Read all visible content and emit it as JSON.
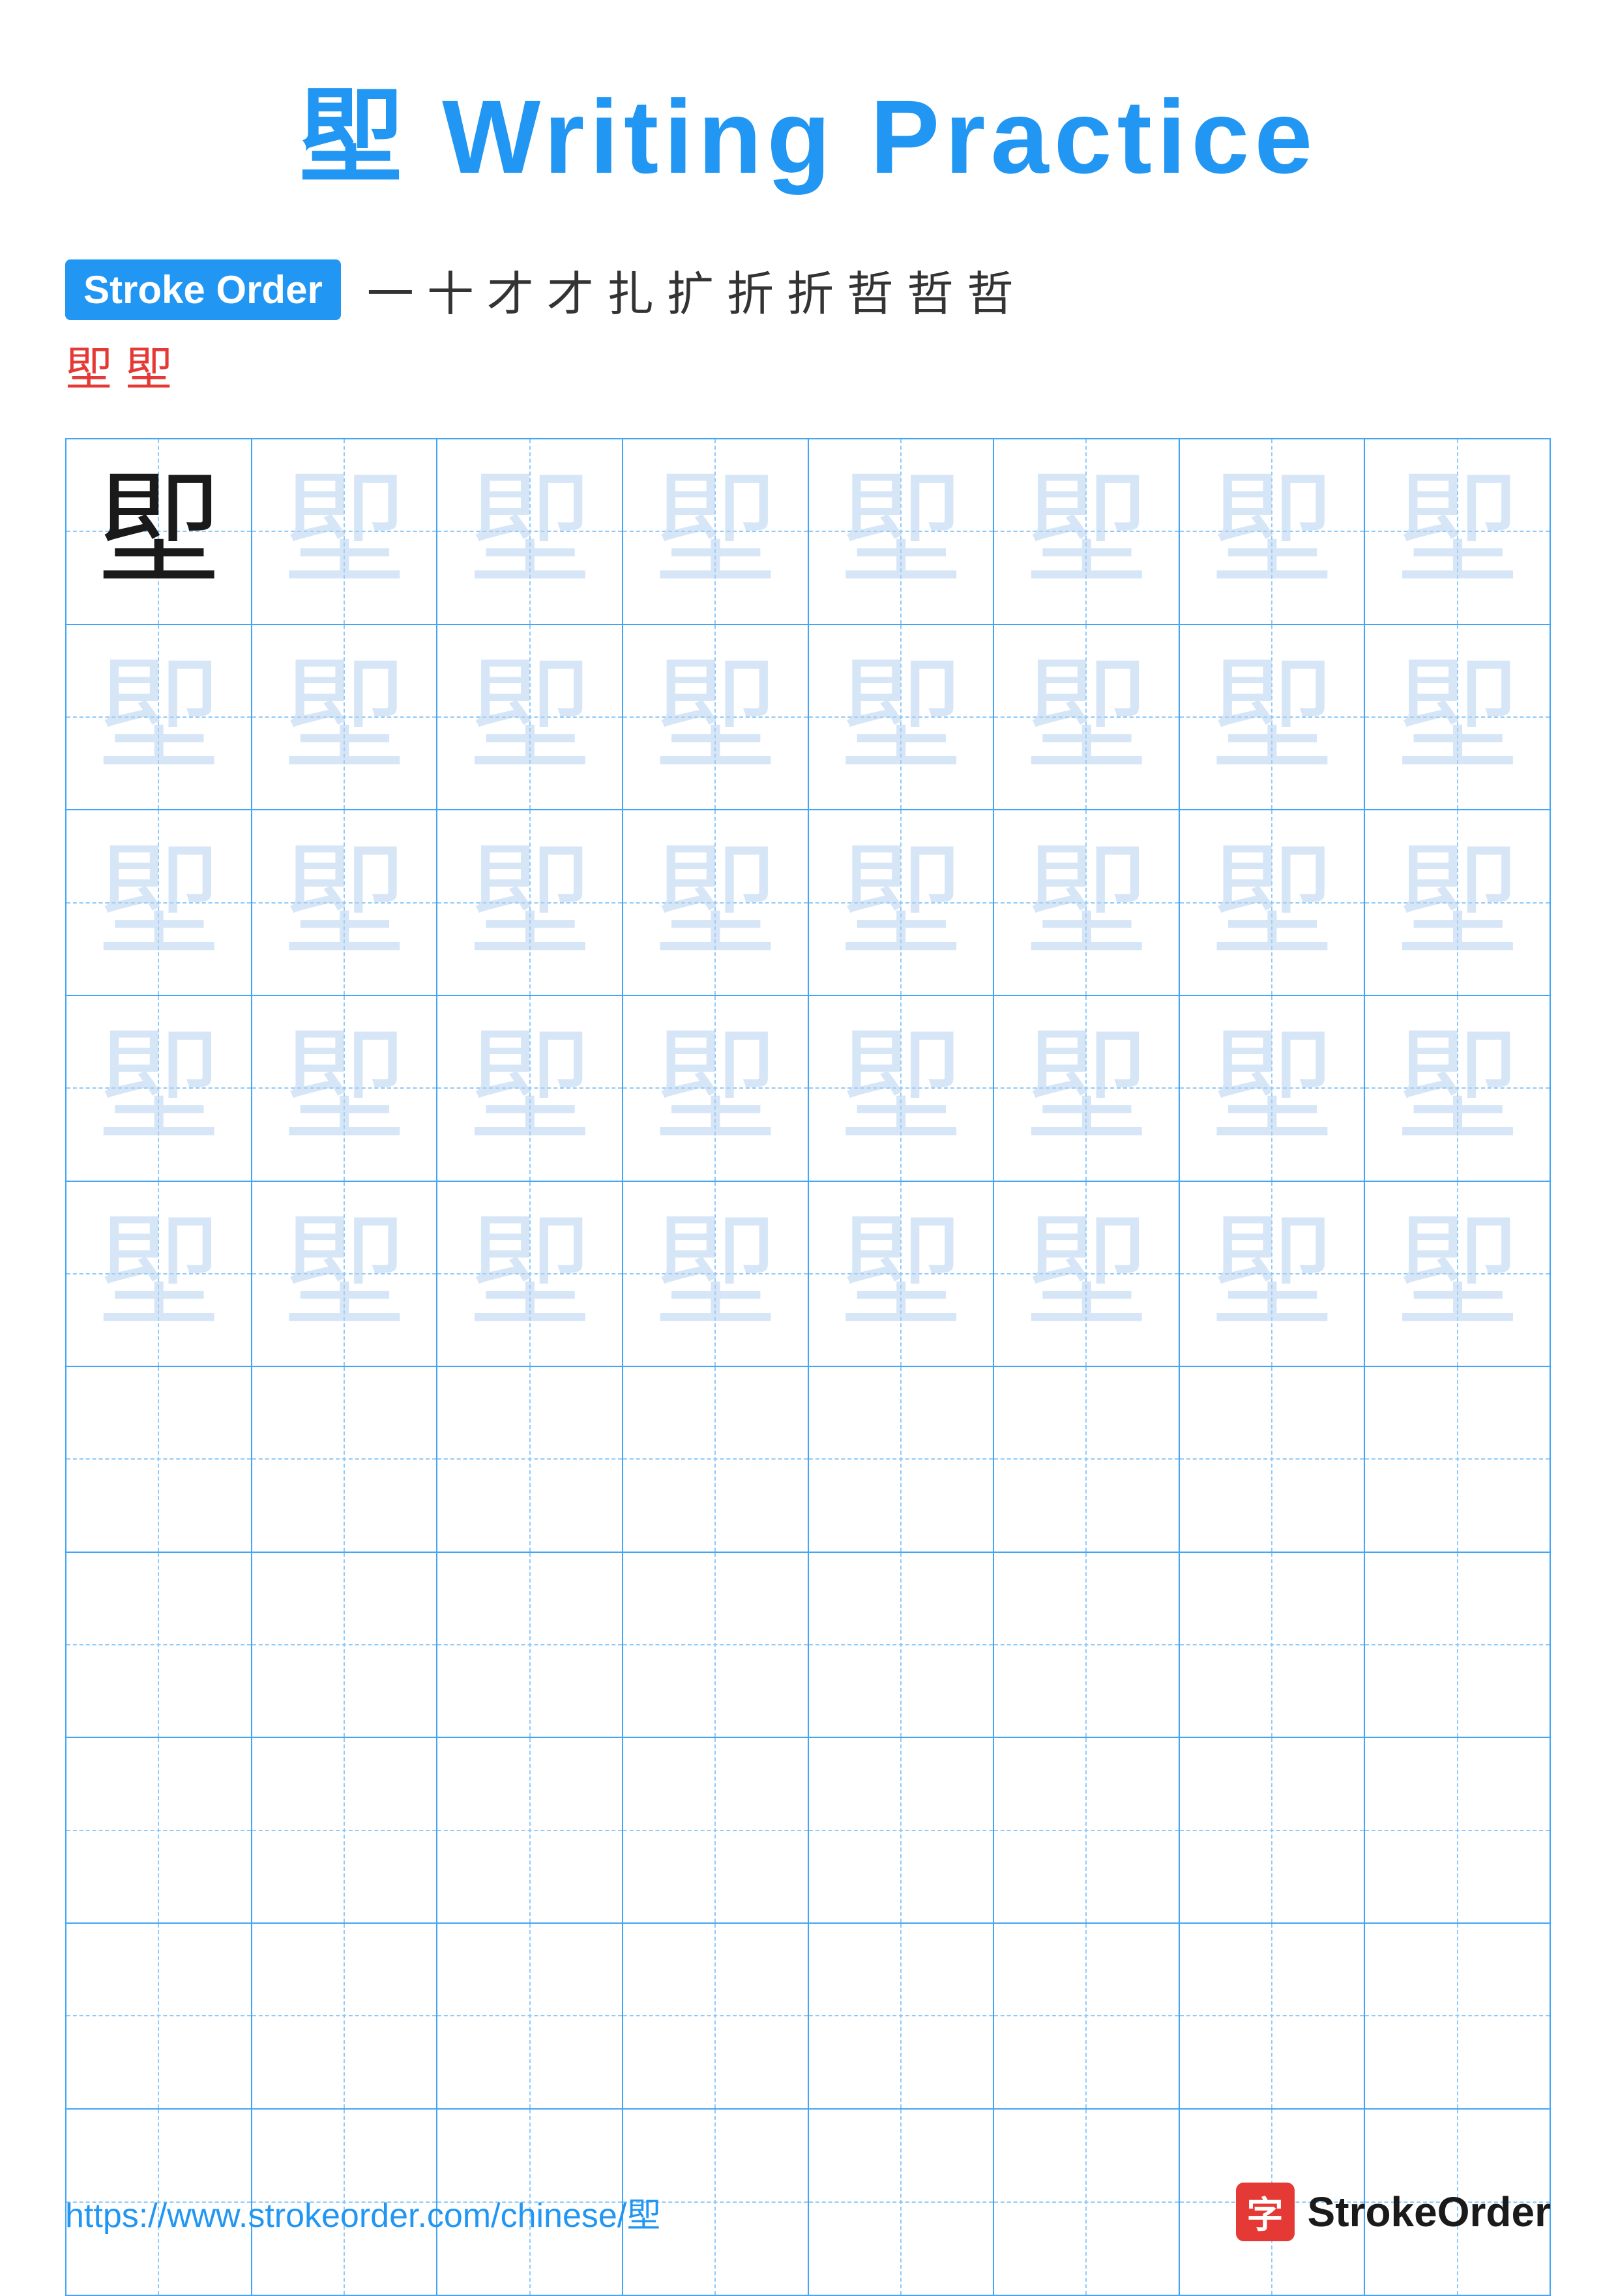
{
  "title": "堲 Writing Practice",
  "stroke_order": {
    "label": "Stroke Order",
    "strokes": [
      "一",
      "十",
      "才",
      "才",
      "扎",
      "扩",
      "折",
      "折",
      "哲",
      "哲",
      "哲",
      "堲",
      "堲"
    ]
  },
  "character": "堲",
  "grid": {
    "cols": 8,
    "rows": 10,
    "ghost_rows": 5,
    "empty_rows": 5
  },
  "footer": {
    "url": "https://www.strokeorder.com/chinese/堲",
    "logo_char": "字",
    "logo_text": "StrokeOrder"
  }
}
